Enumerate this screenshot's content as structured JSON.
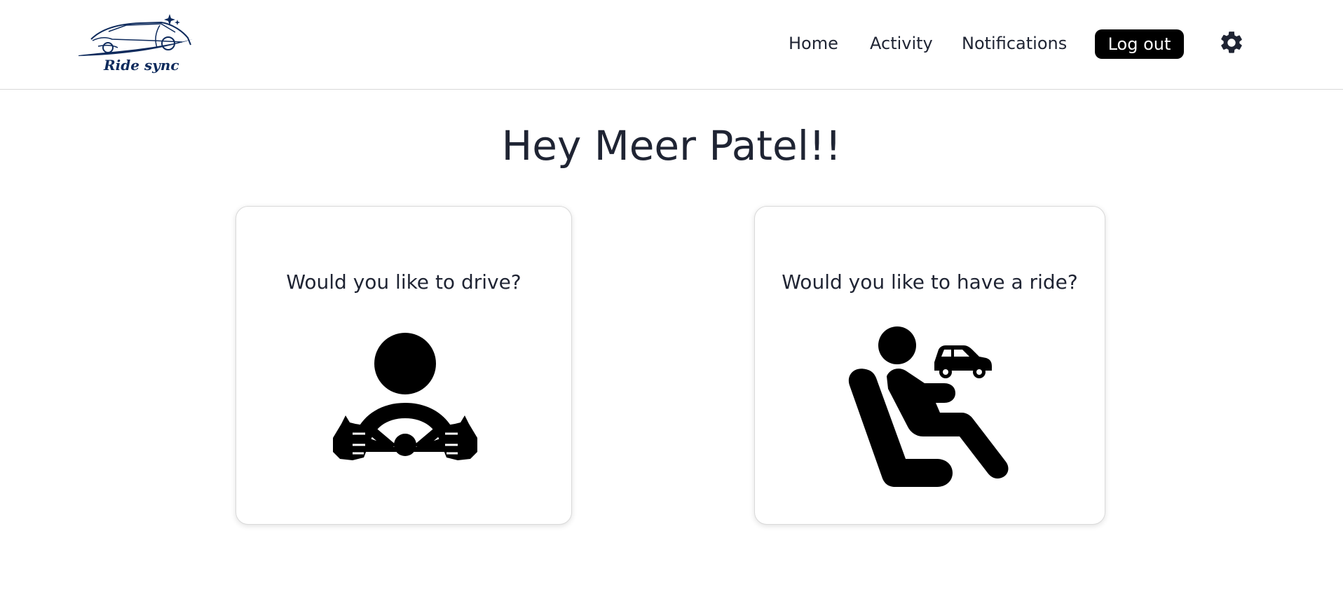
{
  "header": {
    "logo_text": "Ride sync",
    "nav": [
      {
        "label": "Home"
      },
      {
        "label": "Activity"
      },
      {
        "label": "Notifications"
      }
    ],
    "logout_label": "Log out",
    "settings_icon": "gear-icon"
  },
  "main": {
    "greeting": "Hey Meer Patel!!",
    "cards": [
      {
        "title": "Would you like to drive?",
        "icon": "steering-wheel-driver-icon"
      },
      {
        "title": "Would you like to have a ride?",
        "icon": "passenger-seat-icon"
      }
    ]
  },
  "colors": {
    "logo": "#0d2a5c",
    "button_bg": "#000000",
    "button_text": "#ffffff",
    "text": "#1f2433",
    "divider": "#d8d8d8"
  }
}
